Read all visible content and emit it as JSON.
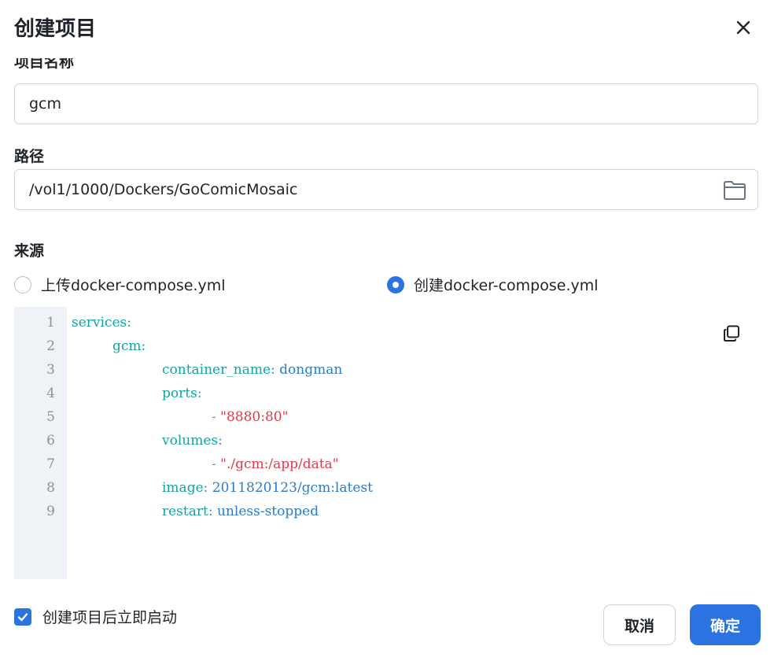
{
  "dialog": {
    "title": "创建项目"
  },
  "project_name": {
    "label": "项目名称",
    "value": "gcm"
  },
  "path": {
    "label": "路径",
    "value": "/vol1/1000/Dockers/GoComicMosaic"
  },
  "source": {
    "label": "来源",
    "options": [
      {
        "label": "上传docker-compose.yml",
        "selected": false
      },
      {
        "label": "创建docker-compose.yml",
        "selected": true
      }
    ]
  },
  "editor": {
    "line_numbers": [
      "1",
      "2",
      "3",
      "4",
      "5",
      "6",
      "7",
      "8",
      "9"
    ],
    "lines": [
      {
        "key": "services",
        "colon": ":",
        "value": ""
      },
      {
        "key": "gcm",
        "colon": ":",
        "value": ""
      },
      {
        "key": "container_name",
        "colon": ": ",
        "value": "dongman"
      },
      {
        "key": "ports",
        "colon": ":",
        "value": ""
      },
      {
        "dash": "- ",
        "string": "\"8880:80\""
      },
      {
        "key": "volumes",
        "colon": ":",
        "value": ""
      },
      {
        "dash": "- ",
        "string": "\"./gcm:/app/data\""
      },
      {
        "key": "image",
        "colon": ": ",
        "value": "2011820123/gcm:latest"
      },
      {
        "key": "restart",
        "colon": ": ",
        "value": "unless-stopped"
      }
    ]
  },
  "autostart": {
    "label": "创建项目后立即启动",
    "checked": true
  },
  "buttons": {
    "cancel": "取消",
    "confirm": "确定"
  },
  "colors": {
    "accent": "#2a73e0",
    "yaml_key": "#14a3a3",
    "yaml_value": "#2a7cc7",
    "yaml_string": "#e0394a"
  },
  "icons": {
    "close": "close-icon",
    "folder": "folder-icon",
    "copy": "copy-icon",
    "check": "check-icon"
  }
}
